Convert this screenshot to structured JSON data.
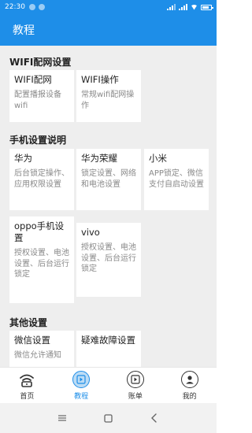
{
  "status_bar": {
    "time": "22:30"
  },
  "app_bar": {
    "title": "教程"
  },
  "sections": [
    {
      "title": "WIFI配网设置",
      "cards": [
        {
          "title": "WIFI配网",
          "desc": "配置播报设备wifi"
        },
        {
          "title": "WIFI操作",
          "desc": "常规wifi配网操作"
        }
      ]
    },
    {
      "title": "手机设置说明",
      "cards": [
        {
          "title": "华为",
          "desc": "后台锁定操作、应用权限设置"
        },
        {
          "title": "华为荣耀",
          "desc": "锁定设置、网络和电池设置"
        },
        {
          "title": "小米",
          "desc": "APP锁定、微信支付自启动设置"
        },
        {
          "title": "oppo手机设置",
          "desc": "授权设置、电池设置、后台运行锁定"
        },
        {
          "title": "vivo",
          "desc": "授权设置、电池设置、后台运行锁定"
        }
      ]
    },
    {
      "title": "其他设置",
      "cards": [
        {
          "title": "微信设置",
          "desc": "微信允许通知"
        },
        {
          "title": "疑难故障设置",
          "desc": ""
        }
      ]
    }
  ],
  "bottom_nav": [
    {
      "label": "首页",
      "icon": "wifi-signal-icon",
      "active": false
    },
    {
      "label": "教程",
      "icon": "play-book-icon",
      "active": true
    },
    {
      "label": "账单",
      "icon": "bill-icon",
      "active": false
    },
    {
      "label": "我的",
      "icon": "profile-icon",
      "active": false
    }
  ],
  "colors": {
    "accent": "#1e8ee8",
    "background": "#eeeeee",
    "card": "#ffffff"
  }
}
